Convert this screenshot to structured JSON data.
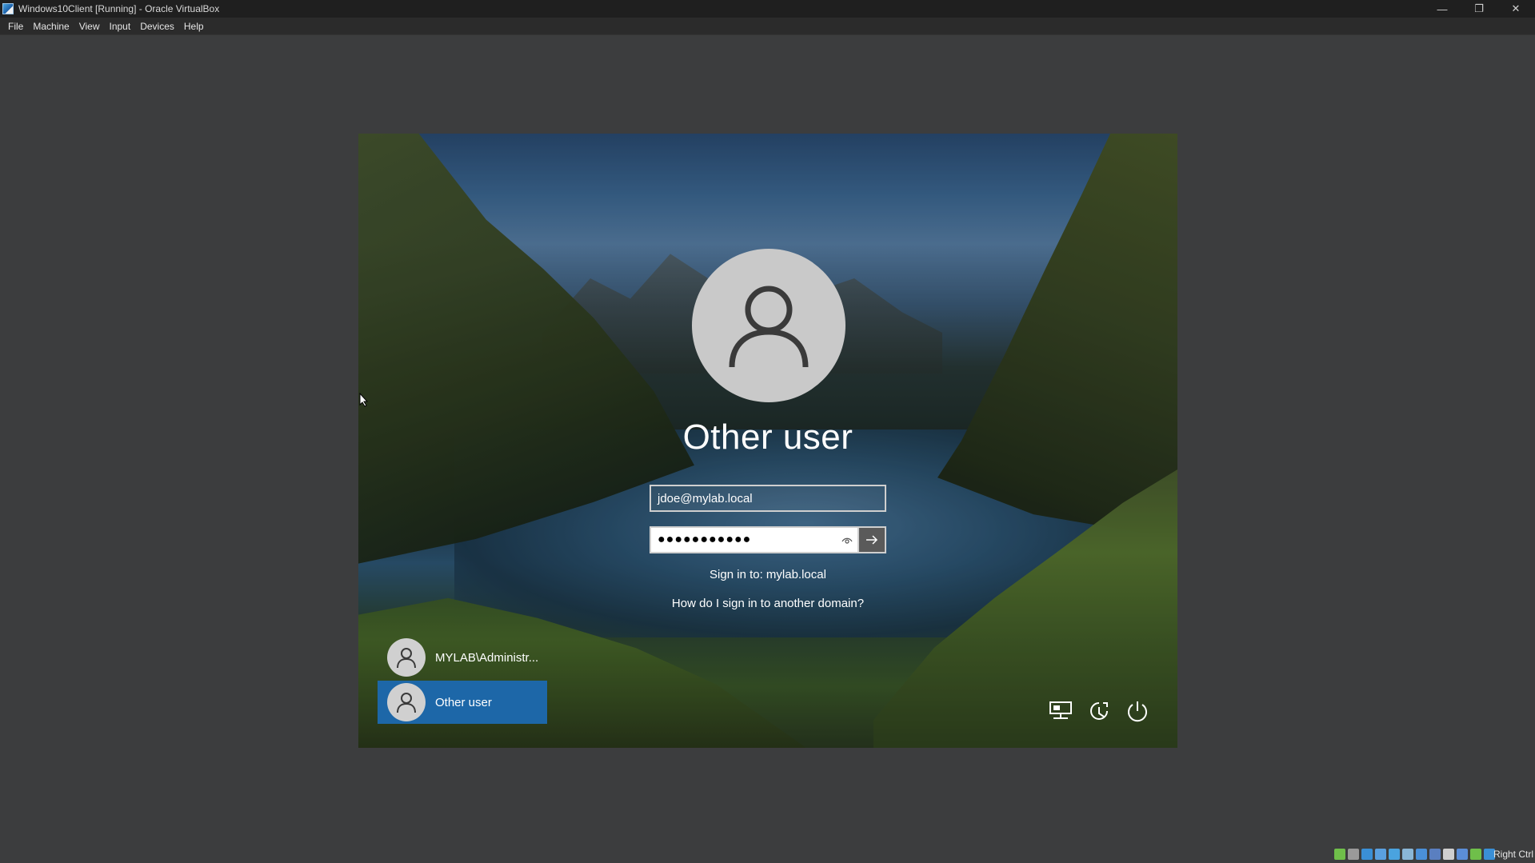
{
  "window": {
    "title": "Windows10Client [Running] - Oracle VirtualBox",
    "controls": {
      "minimize": "—",
      "maximize": "❐",
      "close": "✕"
    }
  },
  "menu": [
    "File",
    "Machine",
    "View",
    "Input",
    "Devices",
    "Help"
  ],
  "login": {
    "user_name": "Other user",
    "username_value": "jdoe@mylab.local",
    "password_mask": "●●●●●●●●●●●",
    "sign_in_to": "Sign in to: mylab.local",
    "domain_help": "How do I sign in to another domain?",
    "user_tiles": [
      {
        "label": "MYLAB\\Administr...",
        "selected": false
      },
      {
        "label": "Other user",
        "selected": true
      }
    ],
    "bottom_icons": [
      "network-icon",
      "ease-of-access-icon",
      "power-icon"
    ]
  },
  "statusbar": {
    "host_key": "Right Ctrl",
    "icons": [
      "hard-disk-icon",
      "optical-drive-icon",
      "audio-icon",
      "network-adapter-icon",
      "usb-icon",
      "shared-folders-icon",
      "display-icon",
      "video-capture-icon",
      "cpu-icon",
      "virtualization-icon",
      "mouse-integration-icon",
      "keyboard-capture-icon"
    ],
    "icon_colors": [
      "#6fbf4a",
      "#9a9a9a",
      "#3a8fd6",
      "#5aa0e0",
      "#4aa3df",
      "#8ab6d6",
      "#4a90d9",
      "#5a7fc0",
      "#cfcfcf",
      "#5b8ed8",
      "#6fbf4a",
      "#3a8fd6"
    ]
  }
}
